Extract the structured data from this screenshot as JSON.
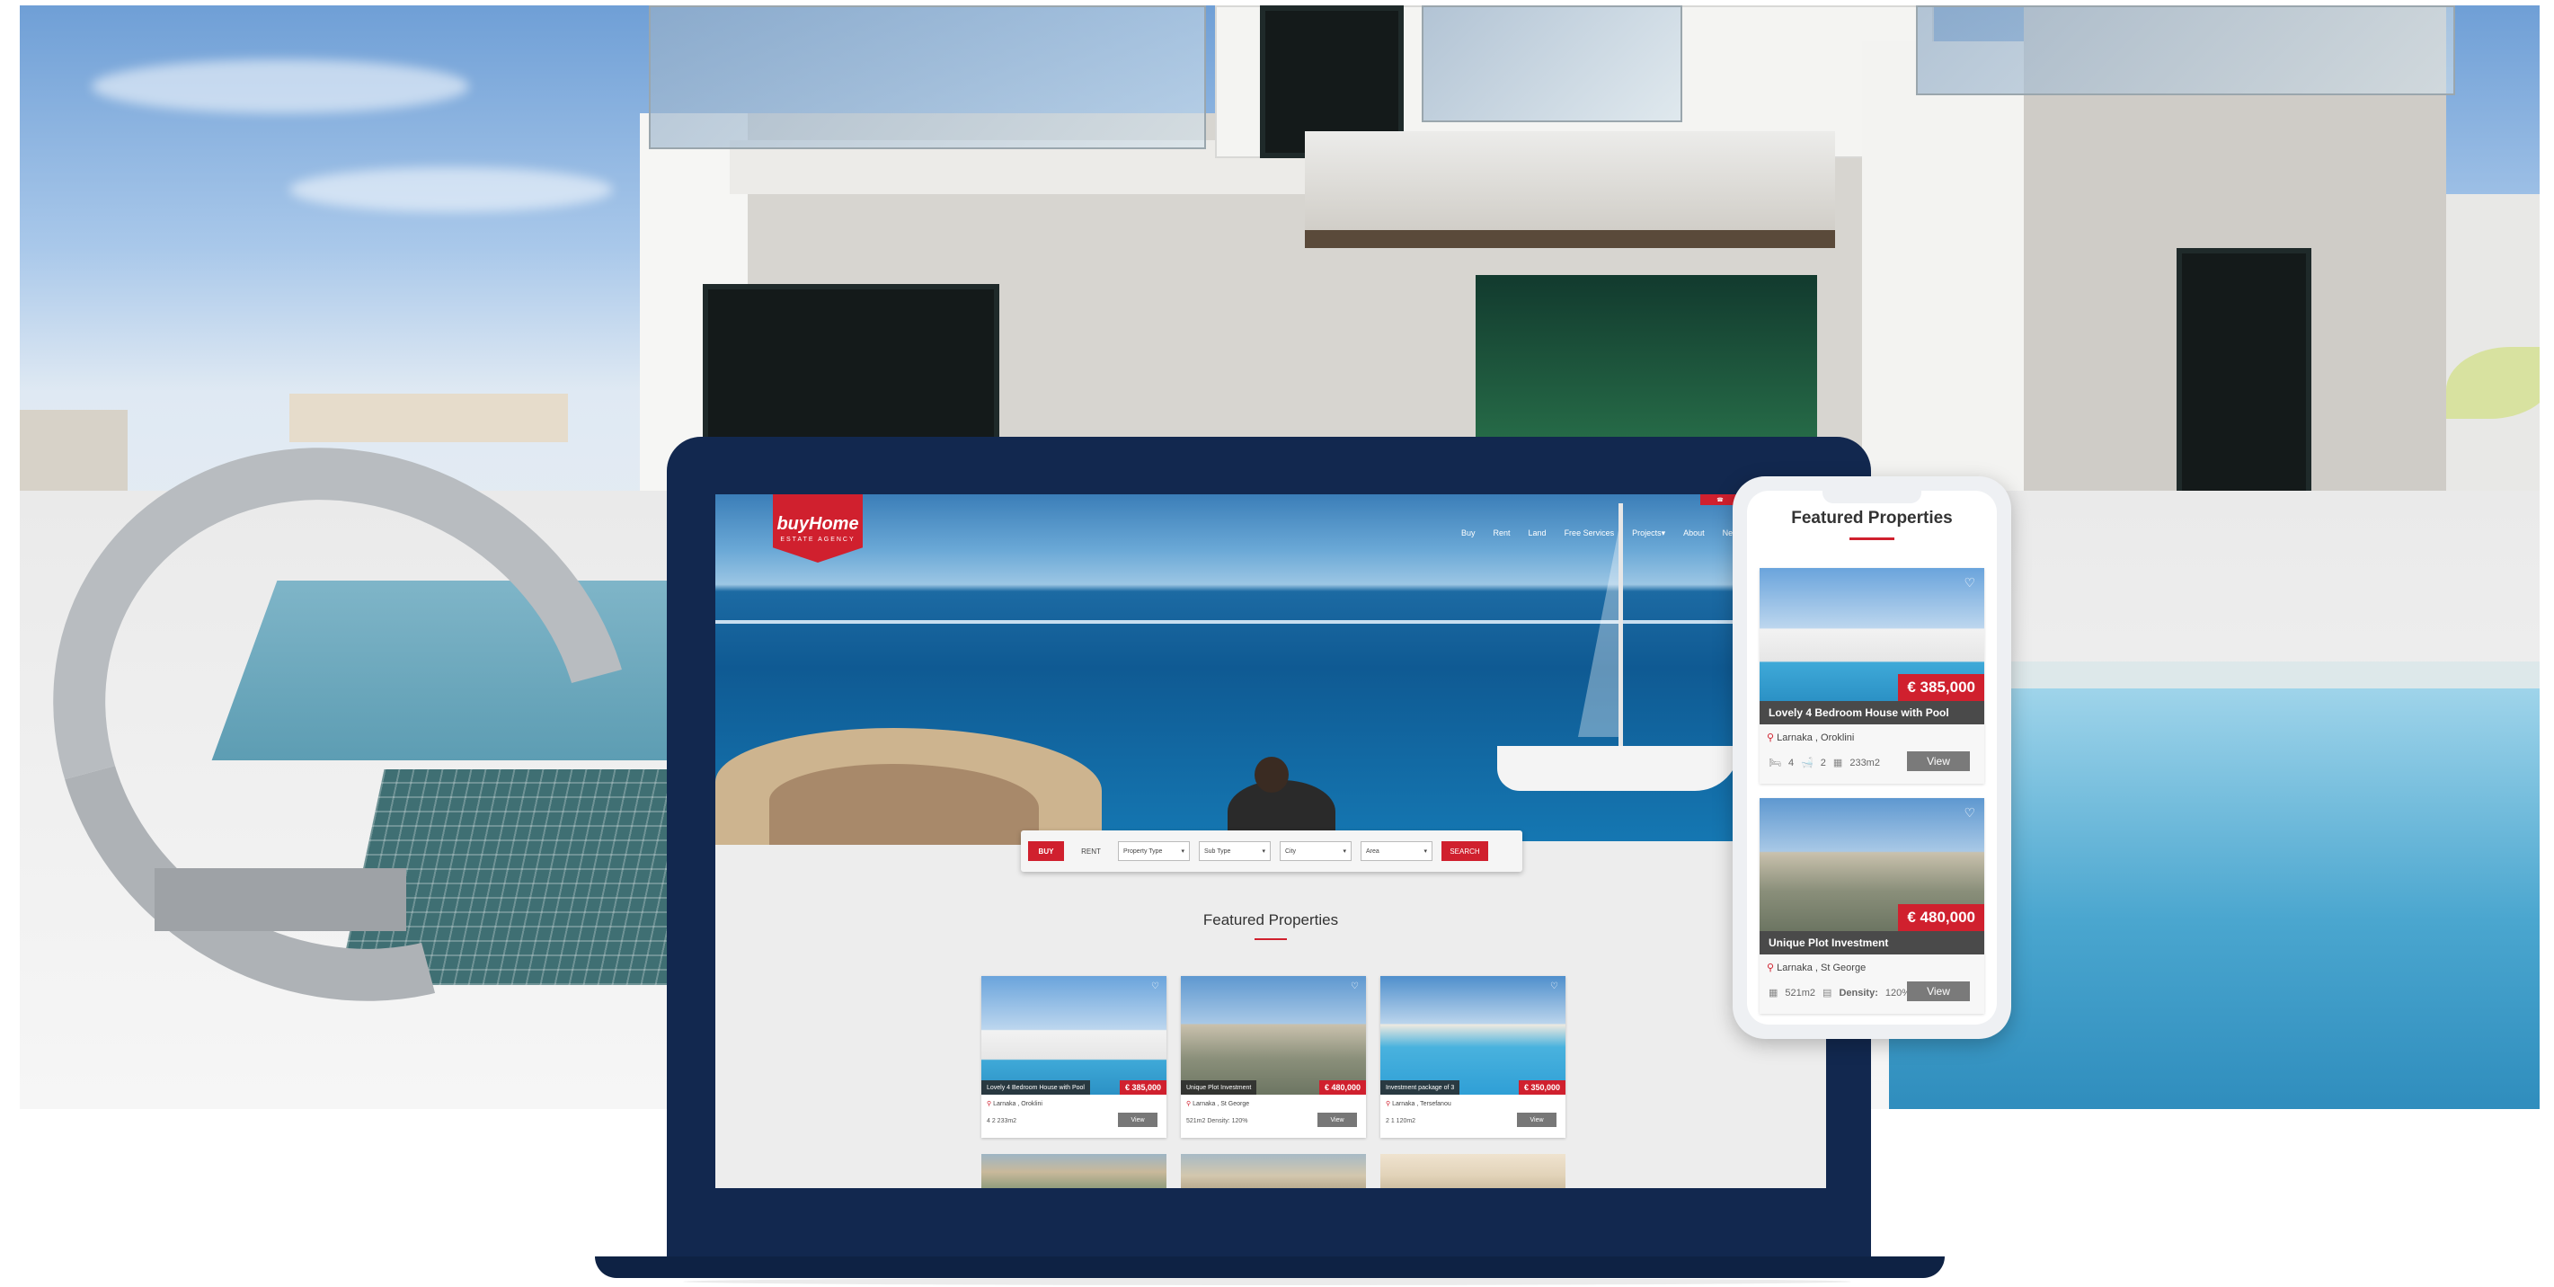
{
  "desktop": {
    "logo": {
      "text": "buyHome",
      "subtext": "ESTATE AGENCY"
    },
    "nav": [
      "Buy",
      "Rent",
      "Land",
      "Free Services",
      "Projects",
      "About",
      "News"
    ],
    "search": {
      "buy_label": "BUY",
      "rent_label": "RENT",
      "property_type": "Property Type",
      "sub_type": "Sub Type",
      "city": "City",
      "area": "Area",
      "search_label": "SEARCH"
    },
    "featured_title": "Featured Properties",
    "cards": [
      {
        "title": "Lovely 4 Bedroom House with Pool",
        "price": "€ 385,000",
        "location": "Larnaka , Oroklini",
        "meta": "4  2  233m2",
        "view": "View"
      },
      {
        "title": "Unique Plot Investment",
        "price": "€ 480,000",
        "location": "Larnaka , St George",
        "meta": "521m2  Density: 120%",
        "view": "View"
      },
      {
        "title": "Investment package of 3",
        "price": "€ 350,000",
        "location": "Larnaka , Tersefanou",
        "meta": "2  1  120m2",
        "view": "View"
      }
    ]
  },
  "mobile": {
    "featured_title": "Featured Properties",
    "cards": [
      {
        "title": "Lovely 4 Bedroom House with Pool",
        "price": "€ 385,000",
        "location": "Larnaka , Oroklini",
        "beds": "4",
        "baths": "2",
        "area": "233m2",
        "view": "View"
      },
      {
        "title": "Unique Plot Investment",
        "price": "€ 480,000",
        "location": "Larnaka , St George",
        "area": "521m2",
        "density_label": "Density:",
        "density": "120%",
        "view": "View"
      }
    ]
  },
  "colors": {
    "brand_red": "#d0202e",
    "laptop_navy": "#12284f"
  }
}
